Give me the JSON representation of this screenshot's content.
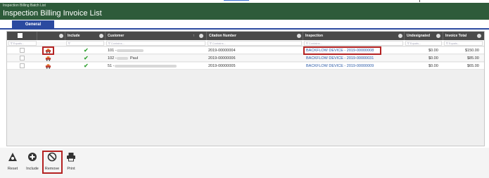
{
  "header": {
    "breadcrumb": "Inspection Billing Batch List",
    "title": "Inspection Billing Invoice List"
  },
  "tabs": [
    {
      "label": "General"
    }
  ],
  "grid": {
    "columns": {
      "include": "Include",
      "customer": "Customer",
      "citation": "Citation Number",
      "inspection": "Inspection",
      "undesignated": "Undesignated",
      "invoice_total": "Invoice Total"
    },
    "filters": {
      "include": "∇",
      "customer": "∇ Contains...",
      "citation": "∇ Contains...",
      "inspection": "∇ Contains...",
      "undesignated": "∇ Equals...",
      "invoice_total": "∇ Equals...",
      "select": "∇ Equals..."
    },
    "rows": [
      {
        "customer": "101 -",
        "citation": "2019-00000004",
        "inspection": "BACKFLOW DEVICE - 2019-00000008",
        "undesignated": "$0.00",
        "invoice_total": "$150.00"
      },
      {
        "customer": "102 -",
        "customer_suffix": "Paul",
        "citation": "2019-00000006",
        "inspection": "BACKFLOW DEVICE - 2019-00000031",
        "undesignated": "$0.00",
        "invoice_total": "$85.00"
      },
      {
        "customer": "51 -",
        "citation": "2019-00000005",
        "inspection": "BACKFLOW DEVICE - 2019-00000009",
        "undesignated": "$0.00",
        "invoice_total": "$65.00"
      }
    ]
  },
  "toolbar": {
    "reset": "Reset",
    "include": "Include",
    "remove": "Remove",
    "print": "Print"
  },
  "colors": {
    "header_bg": "#2e5b3a",
    "tab_bg": "#2b4aa0",
    "highlight": "#b42222",
    "check": "#3aa53a"
  }
}
